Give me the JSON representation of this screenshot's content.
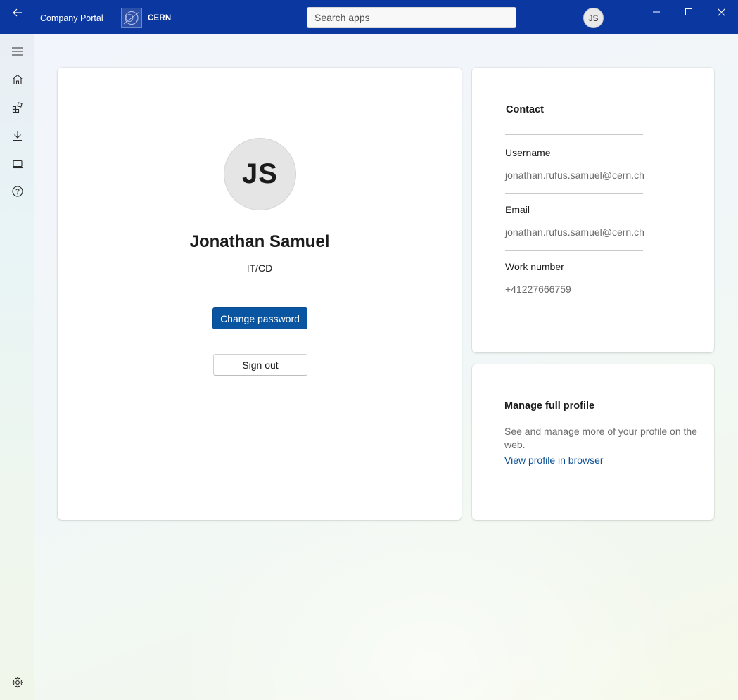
{
  "titlebar": {
    "app_title": "Company Portal",
    "org_name": "CERN",
    "search_placeholder": "Search apps",
    "avatar_initials": "JS",
    "bg_color": "#0b37a1"
  },
  "sidebar": {
    "items": [
      {
        "icon": "hamburger-menu-icon"
      },
      {
        "icon": "home-icon"
      },
      {
        "icon": "apps-icon"
      },
      {
        "icon": "download-icon"
      },
      {
        "icon": "device-icon"
      },
      {
        "icon": "help-icon"
      },
      {
        "icon": "gear-icon"
      }
    ]
  },
  "profile": {
    "initials": "JS",
    "name": "Jonathan Samuel",
    "department": "IT/CD",
    "change_password_label": "Change password",
    "sign_out_label": "Sign out",
    "accent_color": "#0a55a2"
  },
  "contact": {
    "title": "Contact",
    "fields": [
      {
        "label": "Username",
        "value": "jonathan.rufus.samuel@cern.ch"
      },
      {
        "label": "Email",
        "value": "jonathan.rufus.samuel@cern.ch"
      },
      {
        "label": "Work number",
        "value": "+41227666759"
      }
    ]
  },
  "manage": {
    "title": "Manage full profile",
    "description": "See and manage more of your profile on the web.",
    "link_label": "View profile in browser"
  }
}
